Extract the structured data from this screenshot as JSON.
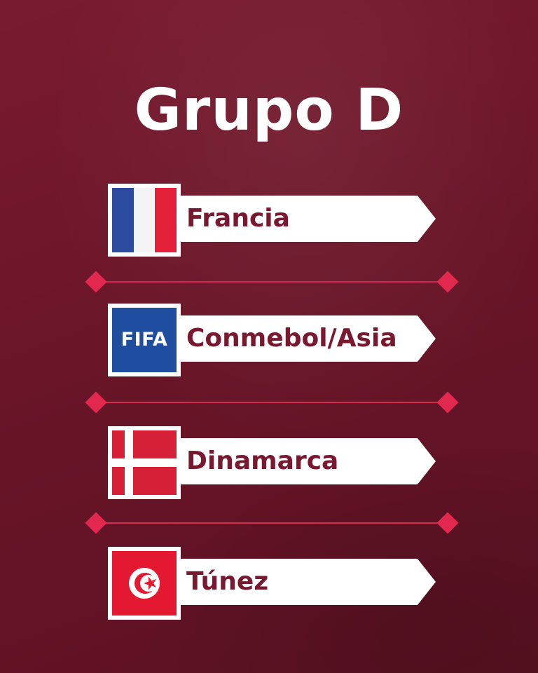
{
  "title": "Grupo D",
  "teams": [
    {
      "name": "Francia",
      "flag_icon": "france-flag-icon"
    },
    {
      "name": "Conmebol/Asia",
      "flag_icon": "fifa-logo-icon",
      "badge_text": "FIFA"
    },
    {
      "name": "Dinamarca",
      "flag_icon": "denmark-flag-icon"
    },
    {
      "name": "Túnez",
      "flag_icon": "tunisia-flag-icon"
    }
  ],
  "colors": {
    "background": "#6a1528",
    "accent": "#e2284e",
    "label_text": "#7a1830",
    "fifa_blue": "#1f4ea1"
  }
}
